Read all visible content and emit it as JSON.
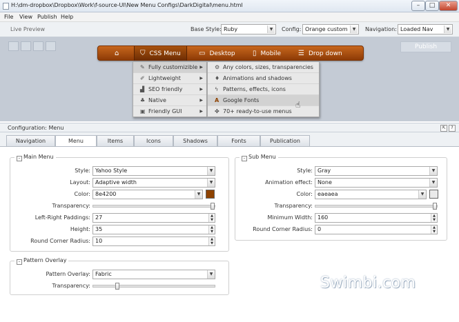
{
  "window": {
    "title": "H:\\dm-dropbox\\Dropbox\\Work\\f-source-UI\\New Menu Configs\\DarkDigital\\menu.html",
    "controls": {
      "minimize": "–",
      "maximize": "□",
      "close": "✕"
    }
  },
  "menubar": {
    "items": [
      "File",
      "View",
      "Publish",
      "Help"
    ]
  },
  "toolbar": {
    "live_preview_label": "Live Preview",
    "base_style_label": "Base Style:",
    "base_style_value": "Ruby",
    "config_label": "Config:",
    "config_value": "Orange custom",
    "navigation_label": "Navigation:",
    "navigation_value": "Loaded Nav"
  },
  "preview": {
    "publish_label": "Publish",
    "nav_items": [
      {
        "label": "",
        "icon": "home-icon"
      },
      {
        "label": "CSS Menu",
        "icon": "html5-icon"
      },
      {
        "label": "Desktop",
        "icon": "monitor-icon"
      },
      {
        "label": "Mobile",
        "icon": "mobile-icon"
      },
      {
        "label": "Drop down",
        "icon": "list-icon"
      }
    ],
    "submenu_1": [
      {
        "label": "Fully customizible",
        "icon": "wrench-icon"
      },
      {
        "label": "Lightweight",
        "icon": "feather-icon"
      },
      {
        "label": "SEO friendly",
        "icon": "signal-icon"
      },
      {
        "label": "Native",
        "icon": "tree-icon"
      },
      {
        "label": "Friendly GUI",
        "icon": "window-icon"
      }
    ],
    "submenu_2": [
      {
        "label": "Any colors, sizes, transparencies",
        "icon": "gears-icon"
      },
      {
        "label": "Animations and shadows",
        "icon": "drop-icon"
      },
      {
        "label": "Patterns, effects, icons",
        "icon": "bolt-icon"
      },
      {
        "label": "Google Fonts",
        "icon": "font-icon"
      },
      {
        "label": "70+ ready-to-use menus",
        "icon": "gift-icon"
      }
    ]
  },
  "config": {
    "title": "Configuration: Menu",
    "tabs": [
      "Navigation",
      "Menu",
      "Items",
      "Icons",
      "Shadows",
      "Fonts",
      "Publication"
    ],
    "active_tab": "Menu",
    "main_menu": {
      "title": "Main Menu",
      "style_label": "Style:",
      "style_value": "Yahoo Style",
      "layout_label": "Layout:",
      "layout_value": "Adaptive width",
      "color_label": "Color:",
      "color_value": "8e4200",
      "transparency_label": "Transparency:",
      "transparency_level": 1.0,
      "paddings_label": "Left-Right Paddings:",
      "paddings_value": "27",
      "height_label": "Height:",
      "height_value": "35",
      "radius_label": "Round Corner Radius:",
      "radius_value": "10"
    },
    "sub_menu": {
      "title": "Sub Menu",
      "style_label": "Style:",
      "style_value": "Gray",
      "animation_label": "Animation effect:",
      "animation_value": "None",
      "color_label": "Color:",
      "color_value": "eaeaea",
      "transparency_label": "Transparency:",
      "transparency_level": 1.0,
      "min_width_label": "Minimum Width:",
      "min_width_value": "160",
      "radius_label": "Round Corner Radius:",
      "radius_value": "0"
    },
    "pattern_overlay": {
      "title": "Pattern Overlay",
      "overlay_label": "Pattern Overlay:",
      "overlay_value": "Fabric",
      "transparency_label": "Transparency:",
      "transparency_level": 0.2
    }
  },
  "watermark": "Swimbi.com",
  "colors": {
    "main_menu": "#8e4200",
    "sub_menu": "#eaeaea",
    "nav_bar": "#b35814"
  }
}
